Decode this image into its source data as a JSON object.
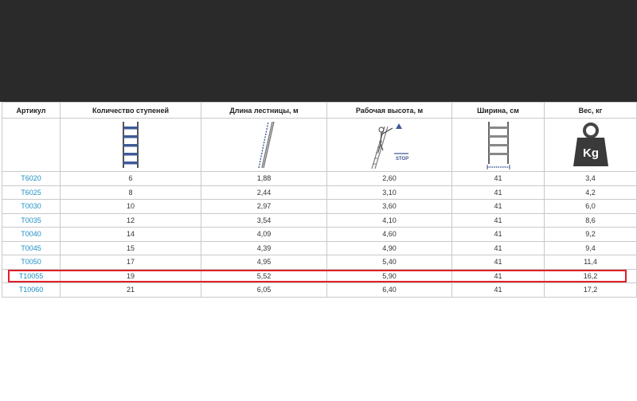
{
  "table": {
    "headers": {
      "sku": "Артикул",
      "steps": "Количество ступеней",
      "length": "Длина лестницы, м",
      "work_height": "Рабочая высота, м",
      "width": "Ширина, см",
      "weight": "Вес, кг"
    },
    "icons": {
      "steps": "ladder-steps-icon",
      "length": "ladder-length-icon",
      "work_height": "working-height-icon",
      "work_height_stop_label": "STOP",
      "width": "ladder-width-icon",
      "weight": "weight-icon",
      "weight_label": "Kg"
    },
    "rows": [
      {
        "sku": "T6020",
        "steps": "6",
        "length": "1,88",
        "work_height": "2,60",
        "width": "41",
        "weight": "3,4"
      },
      {
        "sku": "T6025",
        "steps": "8",
        "length": "2,44",
        "work_height": "3,10",
        "width": "41",
        "weight": "4,2"
      },
      {
        "sku": "T0030",
        "steps": "10",
        "length": "2,97",
        "work_height": "3,60",
        "width": "41",
        "weight": "6,0"
      },
      {
        "sku": "T0035",
        "steps": "12",
        "length": "3,54",
        "work_height": "4,10",
        "width": "41",
        "weight": "8,6"
      },
      {
        "sku": "T0040",
        "steps": "14",
        "length": "4,09",
        "work_height": "4,60",
        "width": "41",
        "weight": "9,2"
      },
      {
        "sku": "T0045",
        "steps": "15",
        "length": "4,39",
        "work_height": "4,90",
        "width": "41",
        "weight": "9,4"
      },
      {
        "sku": "T0050",
        "steps": "17",
        "length": "4,95",
        "work_height": "5,40",
        "width": "41",
        "weight": "11,4"
      },
      {
        "sku": "T10055",
        "steps": "19",
        "length": "5,52",
        "work_height": "5,90",
        "width": "41",
        "weight": "16,2"
      },
      {
        "sku": "T10060",
        "steps": "21",
        "length": "6,05",
        "work_height": "6,40",
        "width": "41",
        "weight": "17,2"
      }
    ],
    "highlighted_sku": "T10055"
  },
  "colors": {
    "topbar": "#2a2a2a",
    "sku_link": "#1d8fc5",
    "highlight": "#e0202a",
    "ladder_blue": "#3f5a96"
  }
}
